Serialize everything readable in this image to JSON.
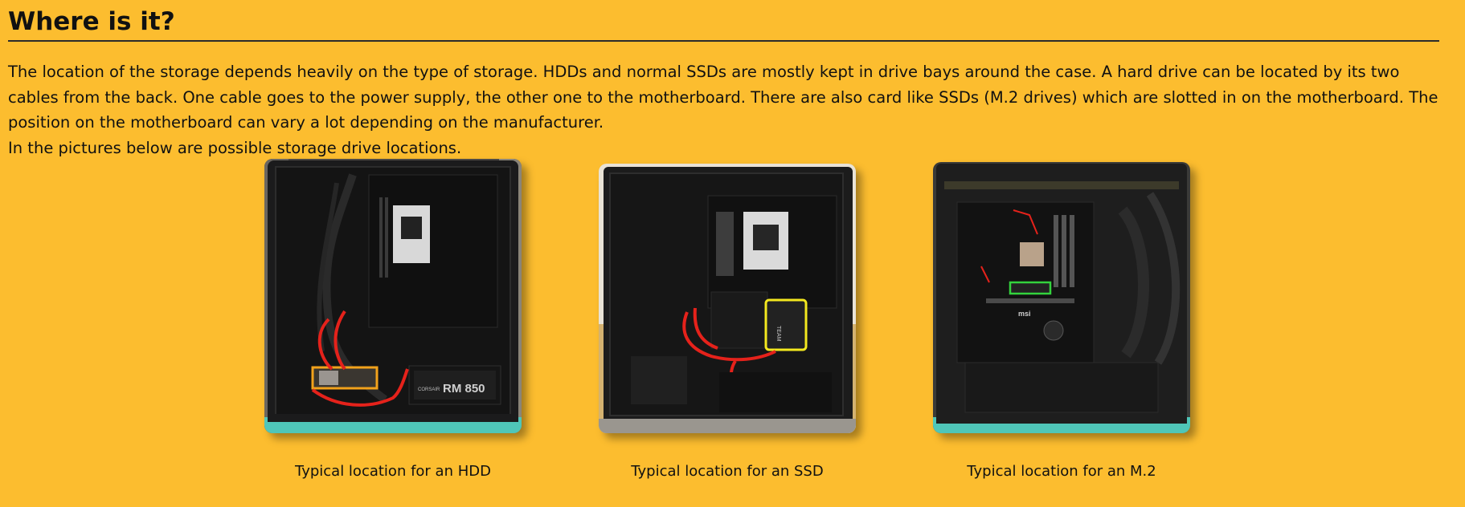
{
  "section": {
    "title": "Where is it?"
  },
  "body": {
    "paragraph1": "The location of the storage depends heavily on the type of storage. HDDs and normal SSDs are mostly kept in drive bays around the case. A hard drive can be located by its two cables from the back. One cable goes to the power supply, the other one to the motherboard. There are also card like SSDs (M.2 drives) which are slotted in on the motherboard. The position on the motherboard can vary a lot depending on the manufacturer.",
    "paragraph2": "In the pictures below are possible storage drive locations."
  },
  "figures": [
    {
      "caption": "Typical location for an HDD",
      "psu_label": "RM 850",
      "psu_brand": "CORSAIR"
    },
    {
      "caption": "Typical location for an SSD",
      "drive_brand": "TEAM"
    },
    {
      "caption": "Typical location for an M.2",
      "board_brand": "msi"
    }
  ],
  "colors": {
    "background": "#FCBD2F",
    "highlight_cable": "#E5221B",
    "highlight_hdd": "#F2A21B",
    "highlight_ssd": "#F3E81F",
    "highlight_m2": "#33D33D"
  }
}
